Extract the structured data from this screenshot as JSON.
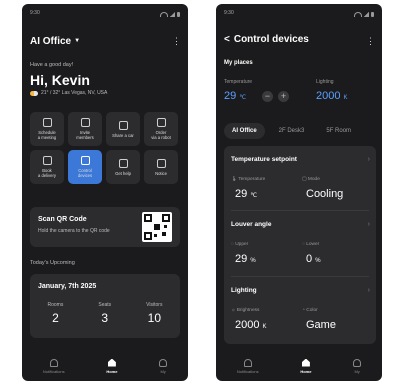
{
  "status": {
    "time": "9:30"
  },
  "left": {
    "office_title": "AI Office",
    "greeting_small": "Have a good day!",
    "greeting": "Hi, Kevin",
    "weather": "21° / 32° Las Vegas, NV, USA",
    "tiles": [
      {
        "label": "Schedule\na meeting",
        "icon": "calendar-icon"
      },
      {
        "label": "Invite\nmembers",
        "icon": "invite-icon"
      },
      {
        "label": "Share a car",
        "icon": "car-icon"
      },
      {
        "label": "Order\nvia a robot",
        "icon": "robot-icon"
      },
      {
        "label": "Book\na delivery",
        "icon": "box-icon"
      },
      {
        "label": "Control\ndevices",
        "icon": "home-control-icon",
        "active": true
      },
      {
        "label": "Get help",
        "icon": "help-icon"
      },
      {
        "label": "Notice",
        "icon": "megaphone-icon"
      }
    ],
    "qr": {
      "title": "Scan QR Code",
      "subtitle": "Hold the camera to the QR code"
    },
    "upcoming_label": "Today's Upcoming",
    "upcoming": {
      "date": "January, 7th 2025",
      "stats": [
        {
          "label": "Rooms",
          "value": "2"
        },
        {
          "label": "Seats",
          "value": "3"
        },
        {
          "label": "Visitors",
          "value": "10"
        }
      ]
    },
    "nav": [
      {
        "label": "Notifications",
        "icon": "bell-icon"
      },
      {
        "label": "Home",
        "icon": "home-icon",
        "active": true
      },
      {
        "label": "My",
        "icon": "person-icon"
      }
    ]
  },
  "right": {
    "title": "Control devices",
    "my_places": "My places",
    "temp_label": "Temperature",
    "temp_value": "29",
    "temp_unit": "℃",
    "light_label": "Lighting",
    "light_value": "2000",
    "light_unit": "K",
    "minus": "−",
    "plus": "+",
    "tabs": [
      {
        "label": "AI Office",
        "active": true
      },
      {
        "label": "2F Desk3"
      },
      {
        "label": "5F Room"
      }
    ],
    "temp_setpoint": {
      "title": "Temperature setpoint",
      "temp_label": "Temperature",
      "temp_value": "29",
      "temp_unit": "℃",
      "mode_label": "Mode",
      "mode_value": "Cooling"
    },
    "louver": {
      "title": "Louver angle",
      "upper_label": "Upper",
      "upper_value": "29",
      "lower_label": "Lower",
      "lower_value": "0",
      "unit": "%"
    },
    "lighting": {
      "title": "Lighting",
      "brightness_label": "Brightness",
      "brightness_value": "2000",
      "brightness_unit": "K",
      "color_label": "Color",
      "color_value": "Game"
    },
    "nav": [
      {
        "label": "Notifications",
        "icon": "bell-icon"
      },
      {
        "label": "Home",
        "icon": "home-icon",
        "active": true
      },
      {
        "label": "My",
        "icon": "person-icon"
      }
    ]
  }
}
